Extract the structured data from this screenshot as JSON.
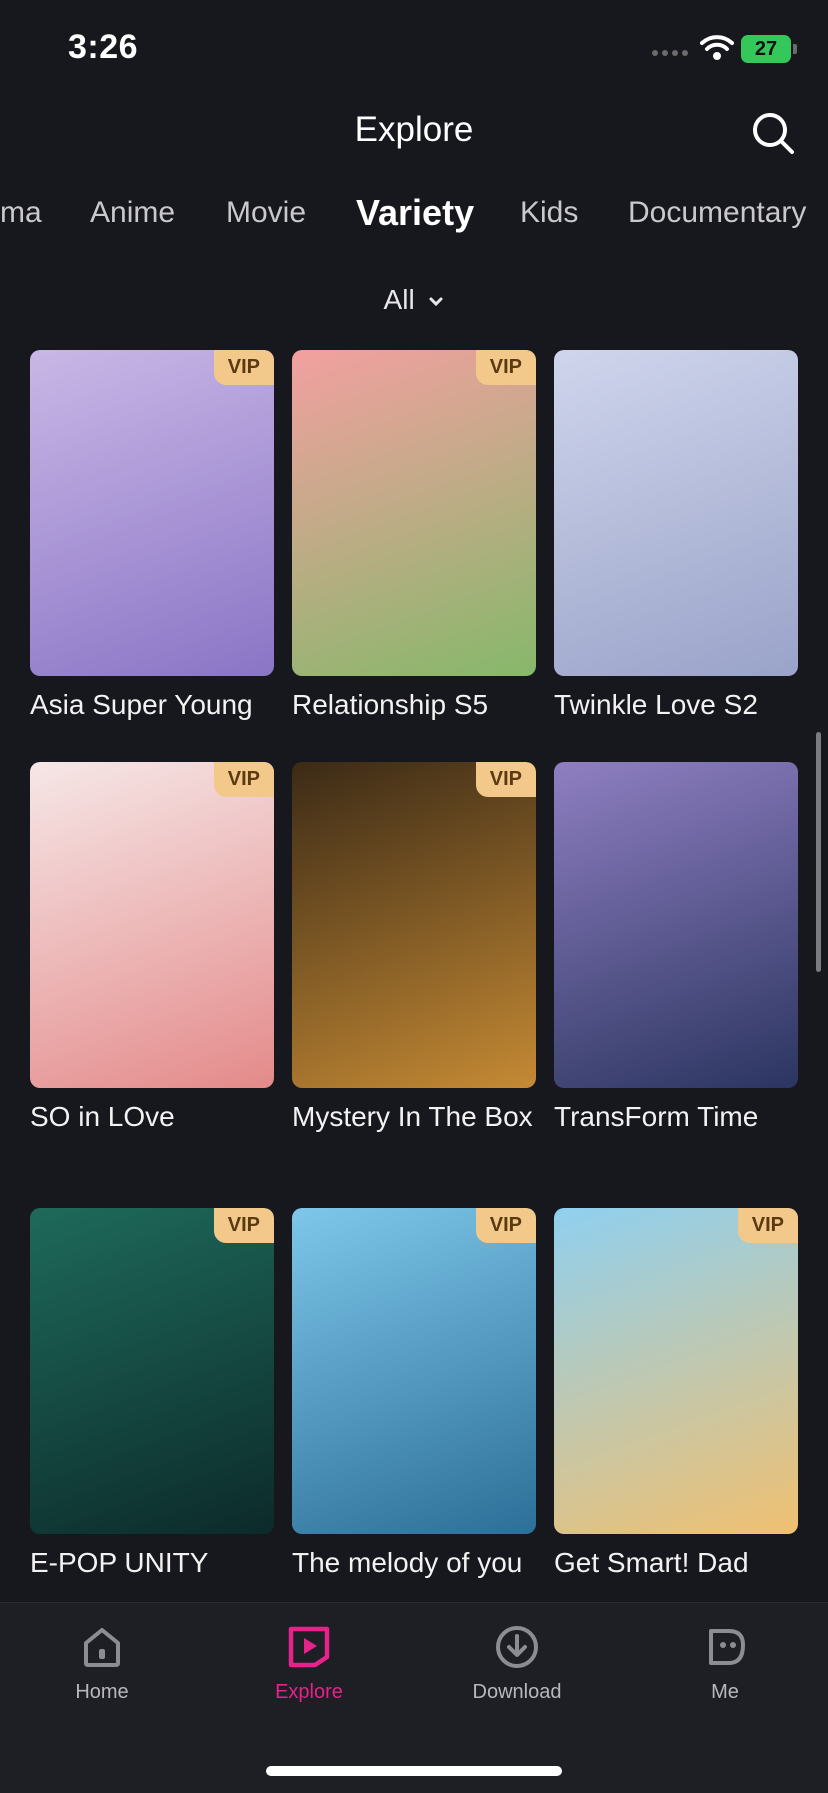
{
  "status_bar": {
    "time": "3:26",
    "battery": "27"
  },
  "header": {
    "title": "Explore"
  },
  "categories": [
    "ma",
    "Anime",
    "Movie",
    "Variety",
    "Kids",
    "Documentary"
  ],
  "active_category": "Variety",
  "filter": {
    "label": "All"
  },
  "badge_label": "VIP",
  "shows": [
    {
      "title": "Asia Super Young",
      "vip": true,
      "colors": [
        "#c9b7e6",
        "#8a75c6"
      ]
    },
    {
      "title": "Relationship S5",
      "vip": true,
      "colors": [
        "#f3a0a0",
        "#86b86a"
      ]
    },
    {
      "title": "Twinkle Love S2",
      "vip": false,
      "colors": [
        "#cfd5ec",
        "#9aa3c9"
      ]
    },
    {
      "title": "SO in LOve",
      "vip": true,
      "colors": [
        "#f6e7e7",
        "#e48a8a"
      ]
    },
    {
      "title": "Mystery In The Box",
      "vip": true,
      "colors": [
        "#3b2a16",
        "#c58a34"
      ]
    },
    {
      "title": "TransForm Time",
      "vip": false,
      "colors": [
        "#8f7fc2",
        "#2b3560"
      ]
    },
    {
      "title": "E-POP UNITY",
      "vip": true,
      "colors": [
        "#1e6a5a",
        "#0c2a2a"
      ]
    },
    {
      "title": "The melody of you",
      "vip": true,
      "colors": [
        "#7ec6ea",
        "#2c6f98"
      ]
    },
    {
      "title": "Get Smart! Dad",
      "vip": true,
      "colors": [
        "#8fd0f0",
        "#f0c070"
      ]
    }
  ],
  "bottom_nav": [
    {
      "label": "Home",
      "icon": "home-icon"
    },
    {
      "label": "Explore",
      "icon": "explore-icon"
    },
    {
      "label": "Download",
      "icon": "download-icon"
    },
    {
      "label": "Me",
      "icon": "me-icon"
    }
  ],
  "colors": {
    "background": "#17171e",
    "accent": "#e6238a",
    "vip_badge": "#f3c98b"
  }
}
